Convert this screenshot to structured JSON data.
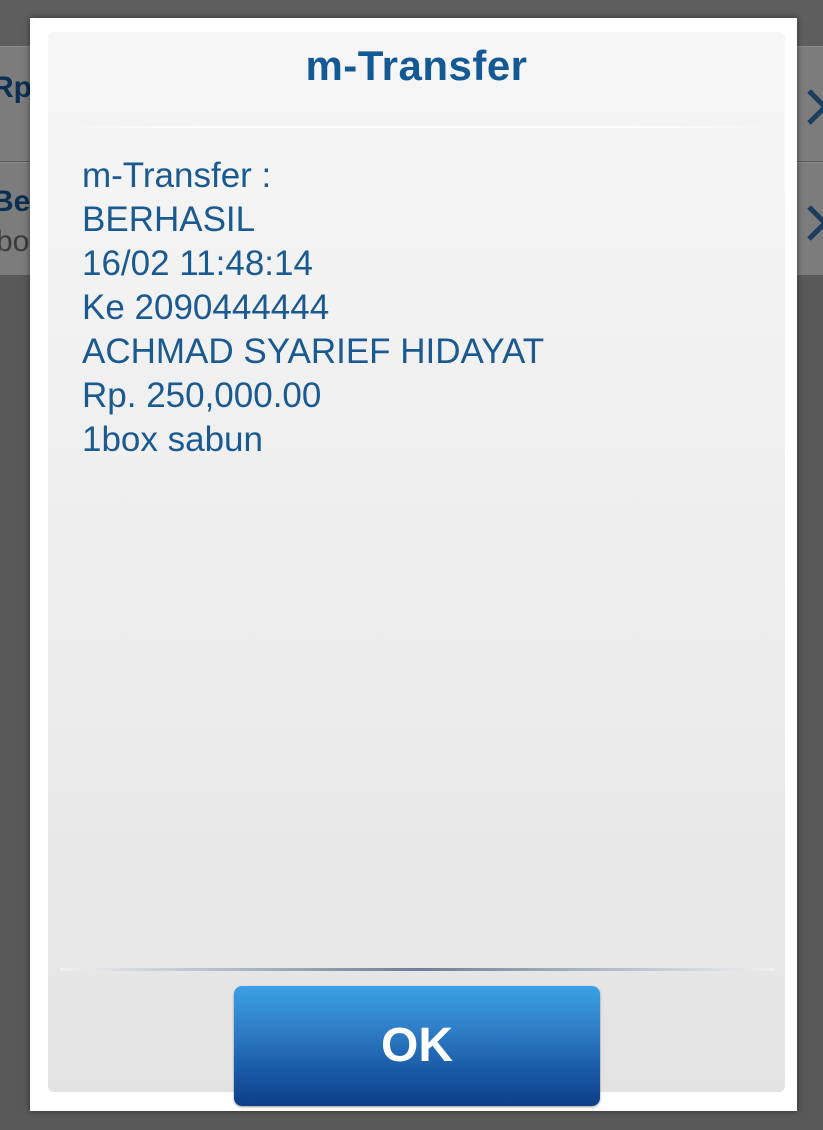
{
  "background": {
    "row1_text": "Rp",
    "row2_text": "Ber",
    "row2_sub": "bo"
  },
  "dialog": {
    "title": "m-Transfer",
    "lines": [
      "m-Transfer :",
      "BERHASIL",
      "16/02 11:48:14",
      "Ke 2090444444",
      "ACHMAD SYARIEF HIDAYAT",
      "Rp. 250,000.00",
      "1box sabun"
    ],
    "ok_label": "OK"
  },
  "colors": {
    "title": "#135a95",
    "text": "#1a5a90",
    "button": "#1a5aa7"
  },
  "icons": {
    "background_row_chevron": "chevron-right-icon"
  }
}
